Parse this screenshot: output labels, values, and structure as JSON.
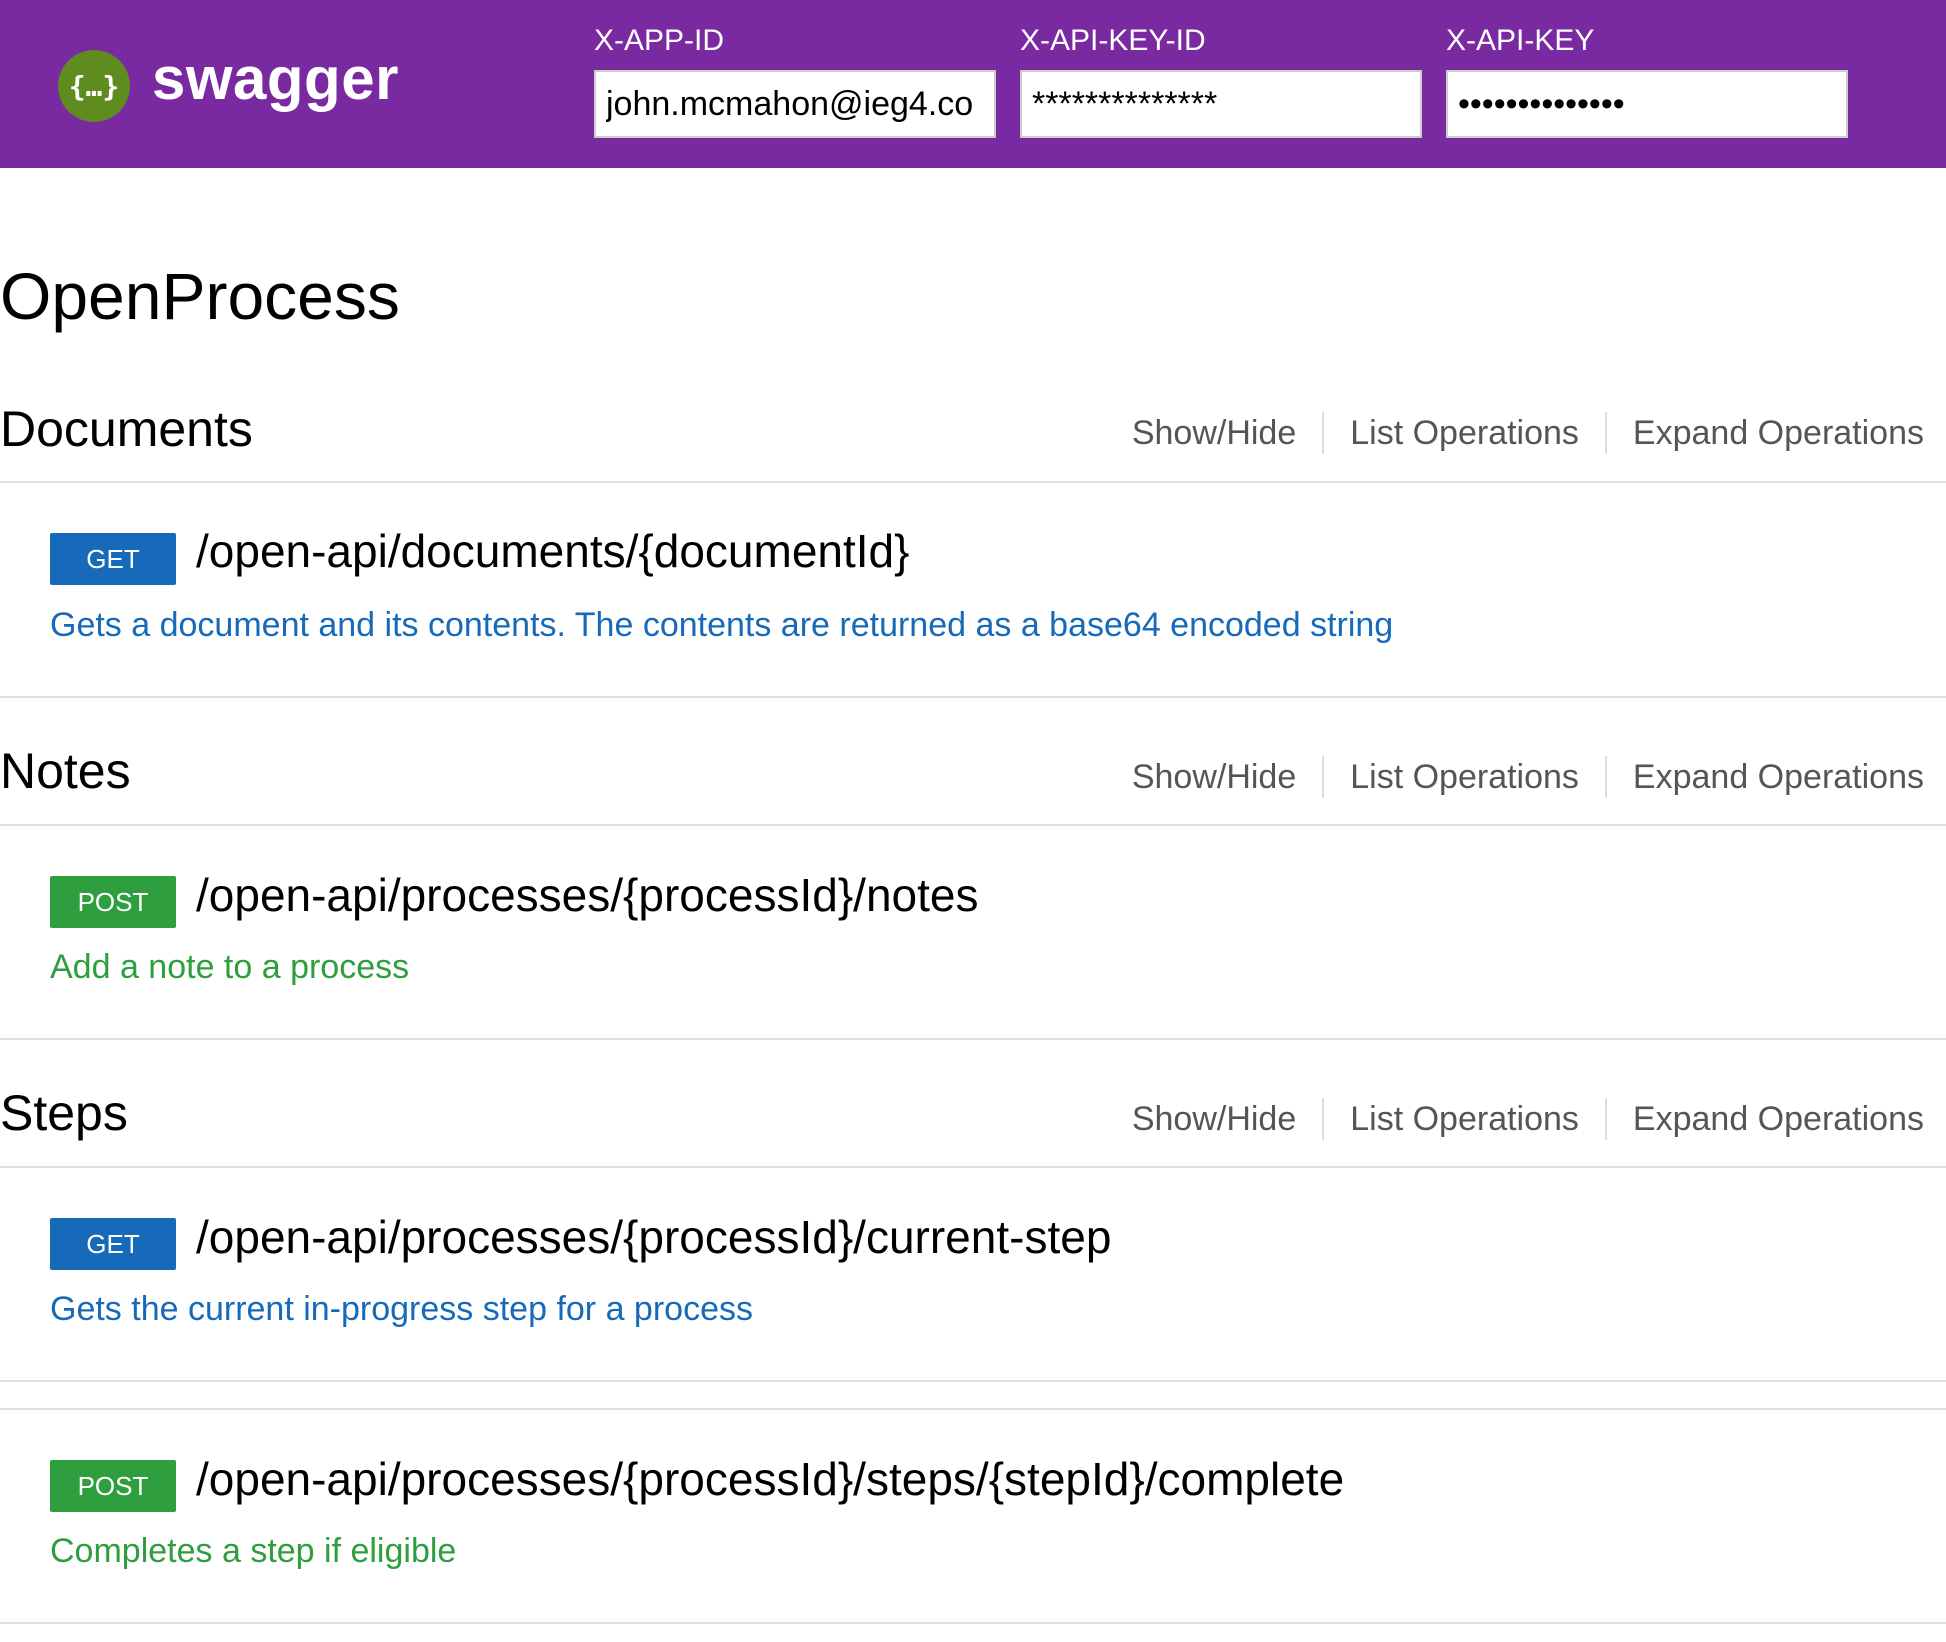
{
  "header": {
    "brand": "swagger",
    "logo_glyph": "{…}",
    "fields": [
      {
        "label": "X-APP-ID",
        "value": "john.mcmahon@ieg4.co",
        "type": "text"
      },
      {
        "label": "X-API-KEY-ID",
        "value": "**************",
        "type": "text"
      },
      {
        "label": "X-API-KEY",
        "value": "**************",
        "type": "password"
      }
    ]
  },
  "page": {
    "title": "OpenProcess"
  },
  "section_actions": {
    "show_hide": "Show/Hide",
    "list_ops": "List Operations",
    "expand_ops": "Expand Operations"
  },
  "sections": [
    {
      "name": "Documents",
      "endpoints": [
        {
          "method": "GET",
          "path": "/open-api/documents/{documentId}",
          "description": "Gets a document and its contents. The contents are returned as a base64 encoded string"
        }
      ]
    },
    {
      "name": "Notes",
      "endpoints": [
        {
          "method": "POST",
          "path": "/open-api/processes/{processId}/notes",
          "description": "Add a note to a process"
        }
      ]
    },
    {
      "name": "Steps",
      "endpoints": [
        {
          "method": "GET",
          "path": "/open-api/processes/{processId}/current-step",
          "description": "Gets the current in-progress step for a process"
        },
        {
          "method": "POST",
          "path": "/open-api/processes/{processId}/steps/{stepId}/complete",
          "description": "Completes a step if eligible"
        }
      ]
    }
  ],
  "colors": {
    "header": "#7a2aa1",
    "get": "#1769ba",
    "post": "#2e9e3e",
    "logo": "#5e8c1f"
  }
}
